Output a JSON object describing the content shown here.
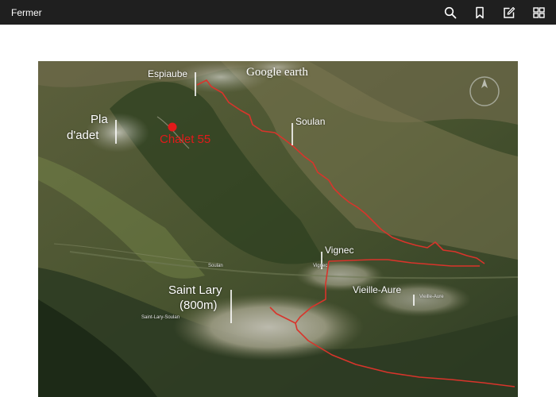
{
  "toolbar": {
    "close_label": "Fermer",
    "icons": [
      "search-icon",
      "bookmark-icon",
      "edit-icon",
      "grid-icon"
    ]
  },
  "map_image": {
    "brand": "Google earth",
    "places": {
      "espiaube": "Espiaube",
      "pla_adet_line1": "Pla",
      "pla_adet_line2": "d'adet",
      "chalet": "Chalet 55",
      "soulan": "Soulan",
      "vignec": "Vignec",
      "vieille_aure": "Vieille-Aure",
      "saint_lary_line1": "Saint Lary",
      "saint_lary_line2": "(800m)"
    },
    "small_labels": {
      "soulan_small": "Soulan",
      "vignec_small": "Vignec",
      "vieille_aure_small": "Vieille-Aure",
      "saint_lary_small": "Saint-Lary-Soulan"
    },
    "colors": {
      "route": "#d9342b",
      "marker": "#e21a1a",
      "label": "#ffffff"
    }
  }
}
